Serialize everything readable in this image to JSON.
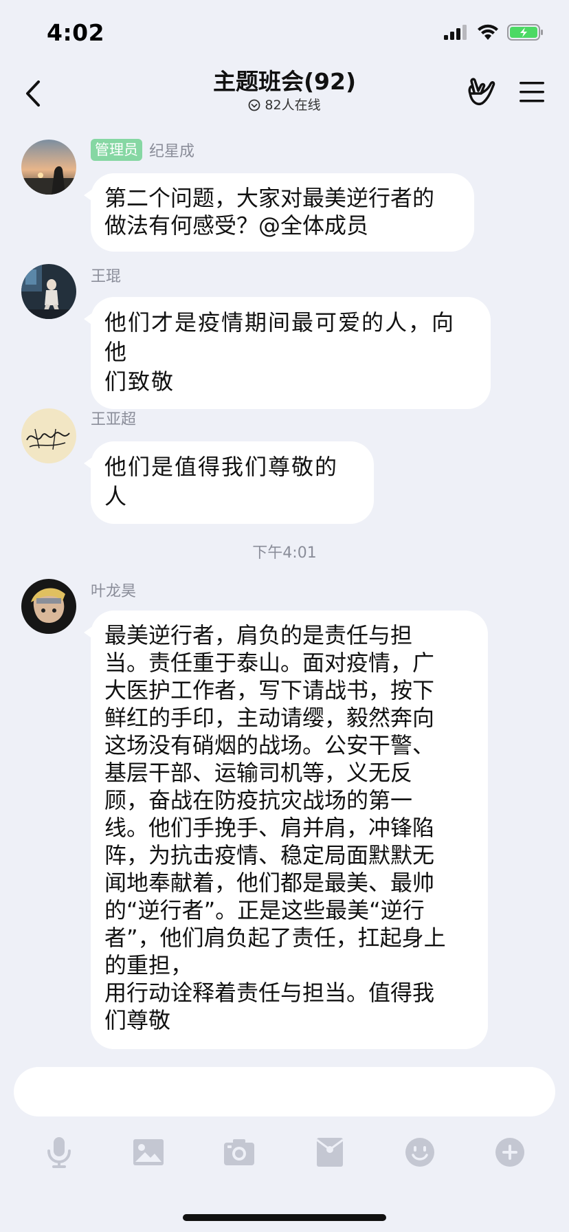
{
  "status_bar": {
    "time": "4:02"
  },
  "header": {
    "title": "主题班会(92)",
    "online": "82人在线"
  },
  "messages": [
    {
      "sender": "纪星成",
      "badge": "管理员",
      "lines": [
        "第二个问题，大家对最美逆行者的",
        "做法有何感受？@全体成员"
      ]
    },
    {
      "sender": "王琨",
      "lines": [
        "他们才是疫情期间最可爱的人，向他",
        "们致敬"
      ]
    },
    {
      "sender": "王亚超",
      "lines": [
        "他们是值得我们尊敬的人"
      ]
    },
    {
      "sender": "叶龙昊",
      "lines": [
        "最美逆行者，肩负的是责任与担",
        "当。责任重于泰山。面对疫情，广",
        "大医护工作者，写下请战书，按下",
        "鲜红的手印，主动请缨，毅然奔向",
        "这场没有硝烟的战场。公安干警、",
        "基层干部、运输司机等，义无反",
        "顾，奋战在防疫抗灾战场的第一",
        "线。他们手挽手、肩并肩，冲锋陷",
        "阵，为抗击疫情、稳定局面默默无",
        "闻地奉献着，他们都是最美、最帅",
        "的“逆行者”。正是这些最美“逆行",
        "者”，他们肩负起了责任，扛起身上",
        "的重担，",
        "用行动诠释着责任与担当。值得我",
        "们尊敬"
      ]
    }
  ],
  "timestamp": "下午4:01",
  "input": {
    "value": "",
    "placeholder": ""
  },
  "toolbar": {
    "icons": [
      "microphone-icon",
      "image-icon",
      "camera-icon",
      "red-packet-icon",
      "emoji-icon",
      "plus-icon"
    ]
  },
  "colors": {
    "background": "#eef0f7",
    "admin_badge": "#86d7a3",
    "battery": "#4cd964"
  }
}
